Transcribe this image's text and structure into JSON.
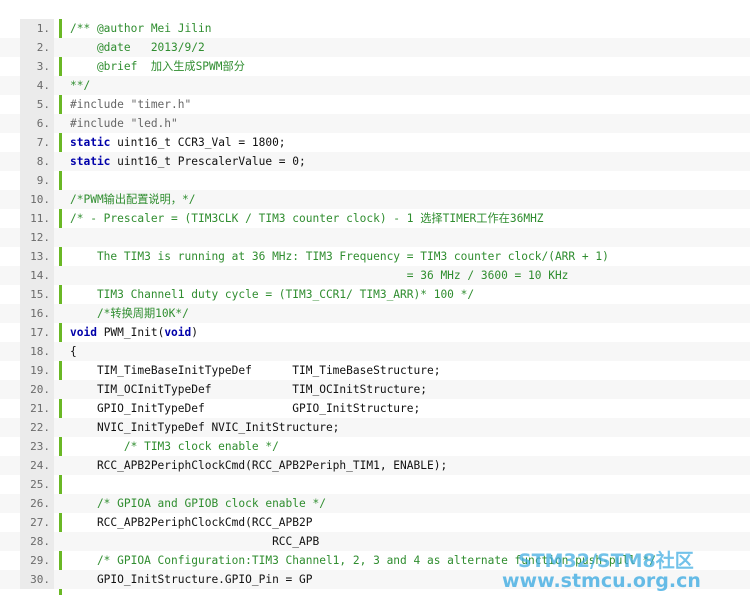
{
  "code_lines": [
    {
      "n": "1.",
      "t": "/** @author Mei Jilin",
      "k": "comment"
    },
    {
      "n": "2.",
      "t": "    @date   2013/9/2",
      "k": "comment"
    },
    {
      "n": "3.",
      "t": "    @brief  加入生成SPWM部分",
      "k": "comment"
    },
    {
      "n": "4.",
      "t": "**/",
      "k": "comment"
    },
    {
      "n": "5.",
      "t": "#include \"timer.h\"",
      "k": "directive"
    },
    {
      "n": "6.",
      "t": "#include \"led.h\"",
      "k": "directive"
    },
    {
      "n": "7.",
      "t": "static uint16_t CCR3_Val = 1800;",
      "k": "kw-decl"
    },
    {
      "n": "8.",
      "t": "static uint16_t PrescalerValue = 0;",
      "k": "kw-decl"
    },
    {
      "n": "9.",
      "t": "",
      "k": "plain"
    },
    {
      "n": "10.",
      "t": "/*PWM输出配置说明，*/",
      "k": "comment"
    },
    {
      "n": "11.",
      "t": "/* - Prescaler = (TIM3CLK / TIM3 counter clock) - 1 选择TIMER工作在36MHZ",
      "k": "comment"
    },
    {
      "n": "12.",
      "t": "",
      "k": "plain"
    },
    {
      "n": "13.",
      "t": "    The TIM3 is running at 36 MHz: TIM3 Frequency = TIM3 counter clock/(ARR + 1)",
      "k": "comment"
    },
    {
      "n": "14.",
      "t": "                                                  = 36 MHz / 3600 = 10 KHz",
      "k": "comment"
    },
    {
      "n": "15.",
      "t": "    TIM3 Channel1 duty cycle = (TIM3_CCR1/ TIM3_ARR)* 100 */",
      "k": "comment"
    },
    {
      "n": "16.",
      "t": "    /*转换周期10K*/",
      "k": "comment"
    },
    {
      "n": "17.",
      "t": "void PWM_Init(void)",
      "k": "kw-func"
    },
    {
      "n": "18.",
      "t": "{",
      "k": "plain"
    },
    {
      "n": "19.",
      "t": "    TIM_TimeBaseInitTypeDef      TIM_TimeBaseStructure;",
      "k": "plain"
    },
    {
      "n": "20.",
      "t": "    TIM_OCInitTypeDef            TIM_OCInitStructure;",
      "k": "plain"
    },
    {
      "n": "21.",
      "t": "    GPIO_InitTypeDef             GPIO_InitStructure;",
      "k": "plain"
    },
    {
      "n": "22.",
      "t": "    NVIC_InitTypeDef NVIC_InitStructure;",
      "k": "plain"
    },
    {
      "n": "23.",
      "t": "        /* TIM3 clock enable */",
      "k": "comment"
    },
    {
      "n": "24.",
      "t": "    RCC_APB2PeriphClockCmd(RCC_APB2Periph_TIM1, ENABLE);",
      "k": "plain"
    },
    {
      "n": "25.",
      "t": "",
      "k": "plain"
    },
    {
      "n": "26.",
      "t": "    /* GPIOA and GPIOB clock enable */",
      "k": "comment"
    },
    {
      "n": "27.",
      "t": "    RCC_APB2PeriphClockCmd(RCC_APB2P",
      "k": "plain"
    },
    {
      "n": "28.",
      "t": "                              RCC_APB",
      "k": "plain"
    },
    {
      "n": "29.",
      "t": "    /* GPIOA Configuration:TIM3 Channel1, 2, 3 and 4 as alternate function push-pull */",
      "k": "comment"
    },
    {
      "n": "30.",
      "t": "    GPIO_InitStructure.GPIO_Pin = GP",
      "k": "plain"
    }
  ],
  "watermark": {
    "line1": "STM32/STM8社区",
    "line2": "www.stmcu.org.cn"
  },
  "colors": {
    "comment": "#2f8d2f",
    "keyword": "#0000aa",
    "gutter_border": "#6ab825",
    "watermark": "#3caae1"
  }
}
